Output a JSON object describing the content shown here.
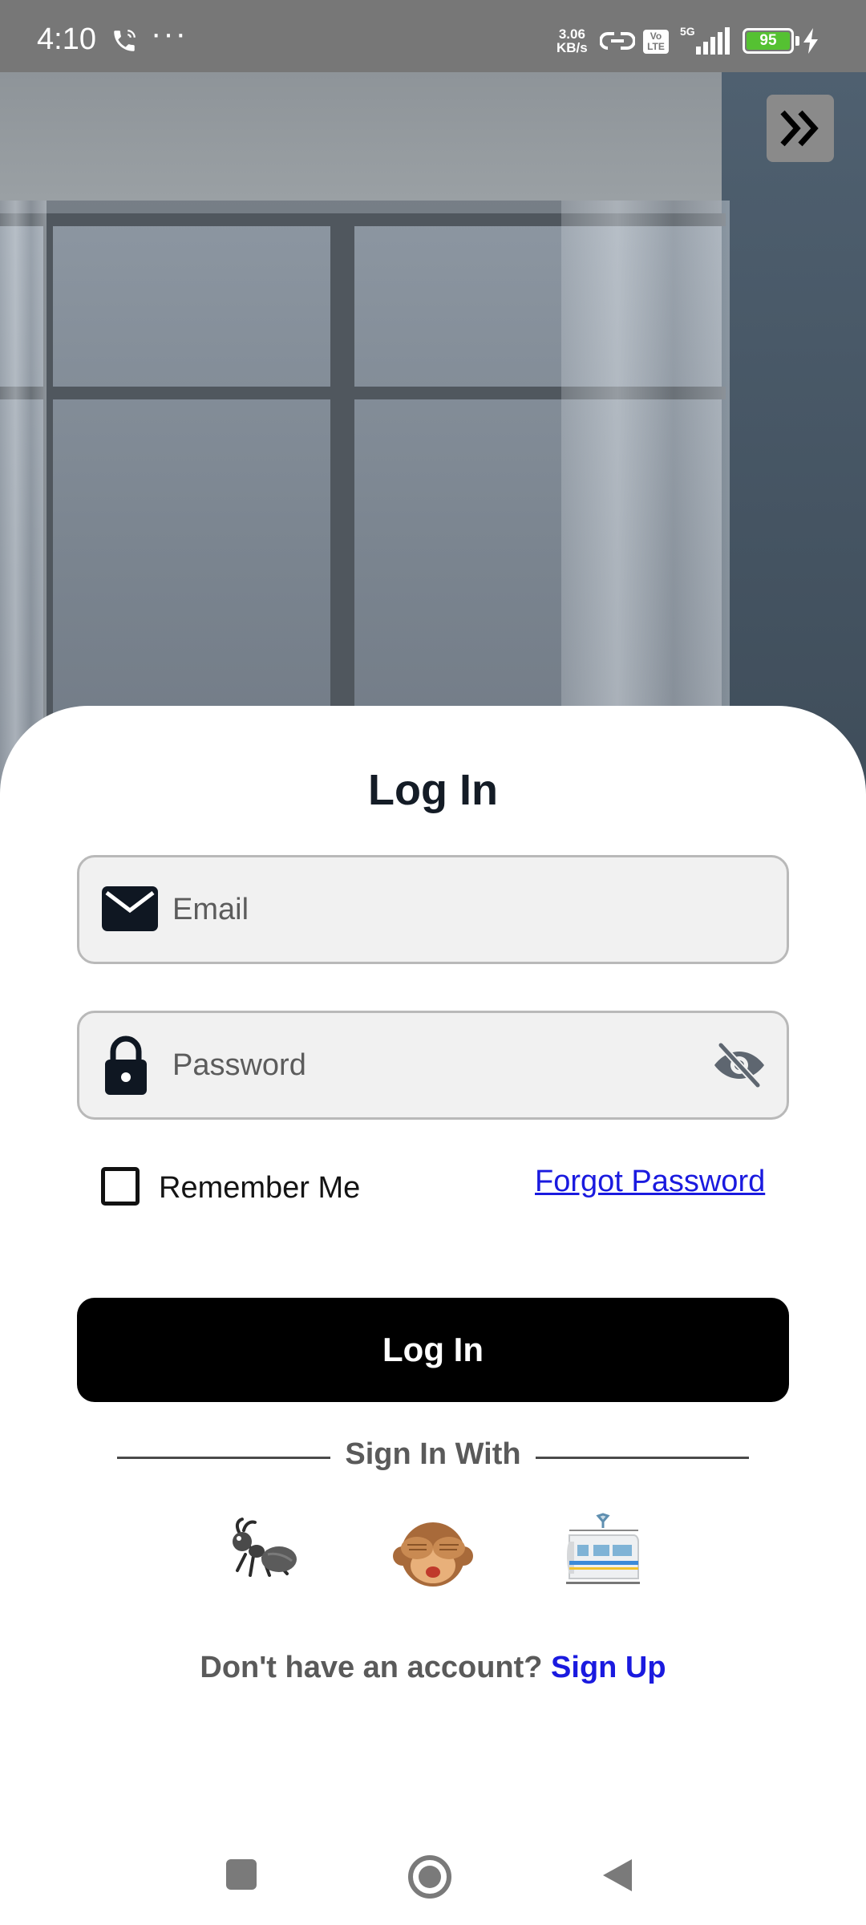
{
  "status_bar": {
    "time": "4:10",
    "net_speed_value": "3.06",
    "net_speed_unit": "KB/s",
    "volte_line1": "Vo",
    "volte_line2": "LTE",
    "network_type": "5G",
    "battery_level": "95",
    "icons": [
      "call-icon",
      "more-dots-icon",
      "hotspot-icon",
      "signal-icon",
      "battery-icon",
      "charging-icon"
    ]
  },
  "header": {
    "skip_icon": "double-chevron-right-icon"
  },
  "login": {
    "title": "Log In",
    "email_placeholder": "Email",
    "email_value": "",
    "password_placeholder": "Password",
    "password_value": "",
    "remember_label": "Remember Me",
    "remember_checked": false,
    "forgot_label": "Forgot Password",
    "submit_label": "Log In",
    "divider_text": "Sign In With",
    "social_providers": [
      "ant-emoji-icon",
      "see-no-evil-monkey-emoji-icon",
      "train-emoji-icon"
    ],
    "signup_prompt": "Don't have an account?",
    "signup_link": "Sign Up"
  },
  "colors": {
    "link": "#1a1adf",
    "button": "#000000",
    "battery": "#55c132"
  }
}
